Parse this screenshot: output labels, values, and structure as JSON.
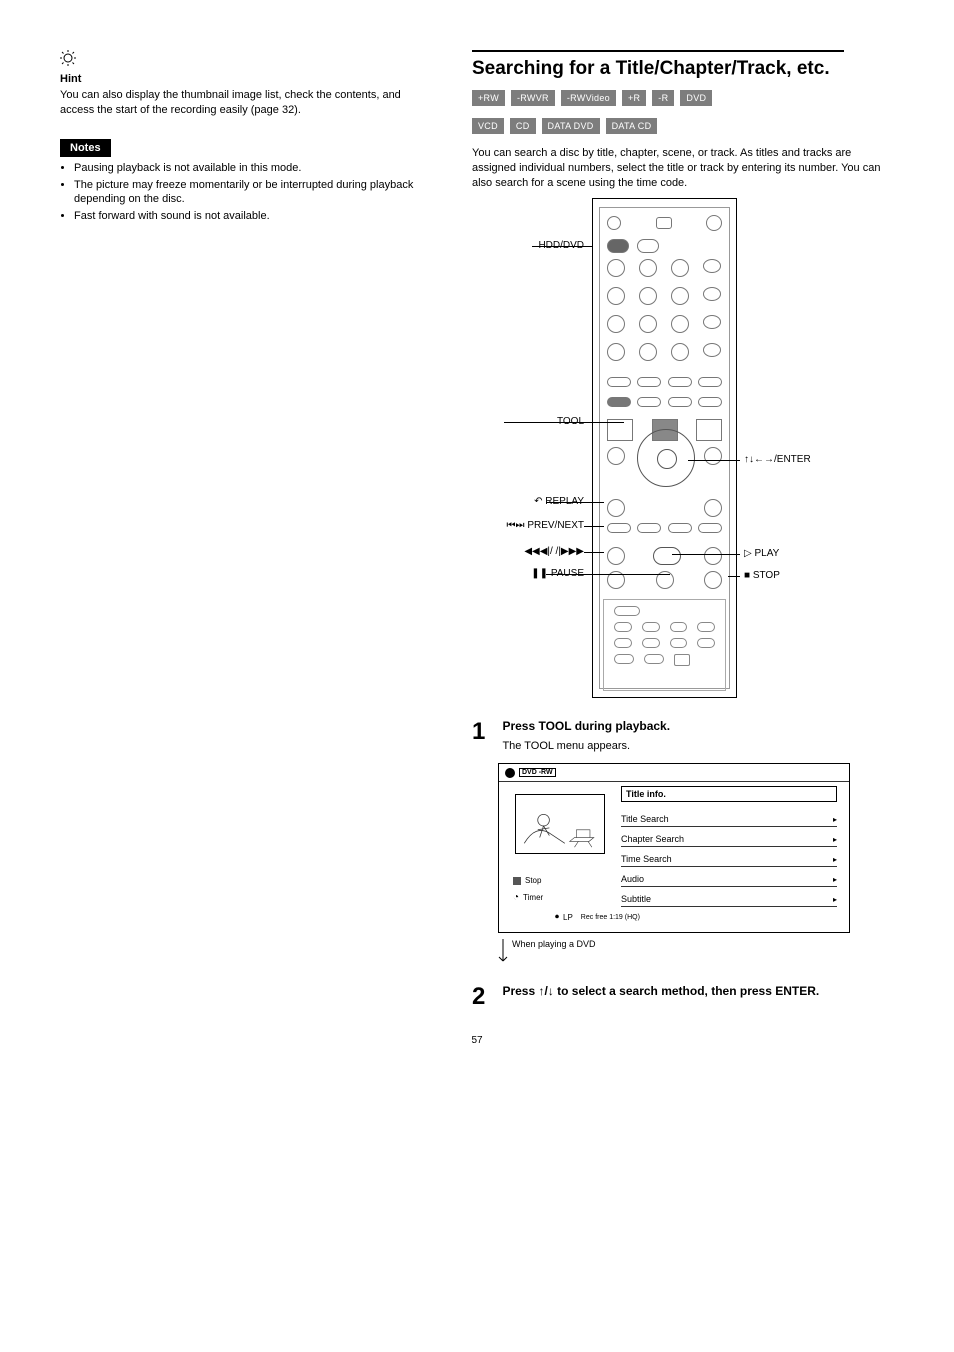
{
  "left": {
    "hint_title": "Hint",
    "hint_body": "You can also display the thumbnail image list, check the contents, and access the start of the recording easily (page 32).",
    "note_badge": "Notes",
    "notes": [
      "Pausing playback is not available in this mode.",
      "The picture may freeze momentarily or be interrupted during playback depending on the disc.",
      "Fast forward with sound is not available."
    ]
  },
  "right": {
    "title": "Searching for a Title/Chapter/Track, etc.",
    "media": [
      "+RW",
      "-RWVR",
      "-RWVideo",
      "+R",
      "-R",
      "DVD",
      "VCD",
      "CD",
      "DATA DVD",
      "DATA CD"
    ],
    "intro": "You can search a disc by title, chapter, scene, or track. As titles and tracks are assigned individual numbers, select the title or track by entering its number. You can also search for a scene using the time code.",
    "callouts": {
      "left": {
        "hdddvd": "HDD/DVD",
        "replay": "REPLAY",
        "prevnext": "PREV/NEXT",
        "seek": "/       /",
        "pause": "PAUSE",
        "tool": "TOOL"
      },
      "right": {
        "arrows": "/ENTER",
        "play": "PLAY",
        "stop": "STOP"
      }
    },
    "step1_num": "1",
    "step1_text": "Press TOOL during playback.",
    "step1_sub": "The TOOL menu appears.",
    "panel": {
      "head_logo": "DVD -RW",
      "title_info": "Title info.",
      "rows": [
        "Title Search",
        "Chapter Search",
        "Time Search",
        "Audio",
        "Subtitle"
      ],
      "status1": "Stop",
      "status2": "Timer",
      "rec_free": "Rec free 1:19 (HQ)"
    },
    "caption_text": "When playing a DVD",
    "step2_num": "2",
    "step2_text": "Press ↑/↓ to select a search method, then press ENTER.",
    "page_num": "57"
  }
}
